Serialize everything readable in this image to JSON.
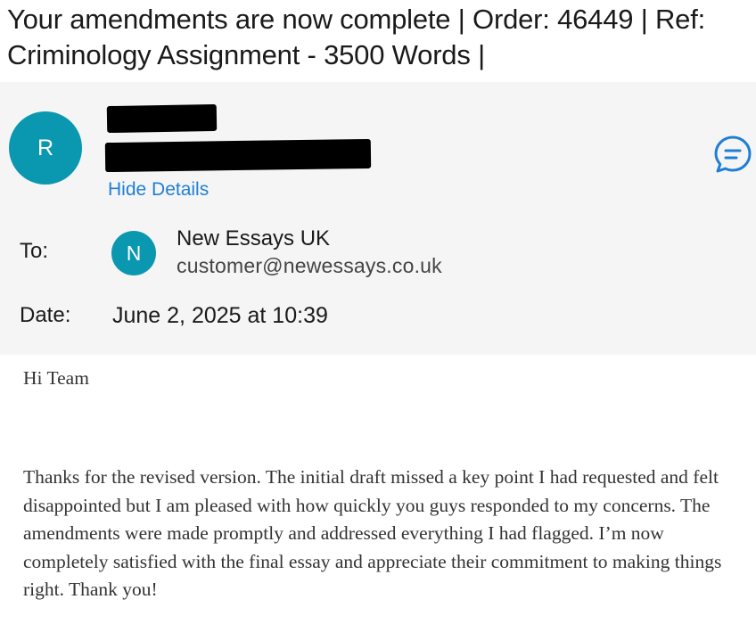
{
  "subject": "Your amendments are now complete | Order: 46449 | Ref: Criminology Assignment - 3500 Words |",
  "sender": {
    "avatar_initial": "R",
    "hide_details_label": "Hide Details",
    "action_icon": "chat-bubble-icon"
  },
  "recipient": {
    "to_label": "To:",
    "avatar_initial": "N",
    "name": "New Essays UK",
    "email": "customer@newessays.co.uk"
  },
  "date": {
    "label": "Date:",
    "value": "June 2, 2025 at 10:39"
  },
  "message": {
    "greeting": "Hi Team",
    "paragraph": "Thanks for the revised version. The initial draft missed a key point I had requested and felt disappointed but I am pleased with how quickly you guys responded to my concerns. The amendments were made promptly and addressed everything I had flagged. I’m now completely satisfied with the final essay and appreciate their commitment to making things right. Thank you!"
  },
  "colors": {
    "avatar": "#0a98b0",
    "link": "#1f7fd6",
    "header_background": "#f5f5f5"
  }
}
